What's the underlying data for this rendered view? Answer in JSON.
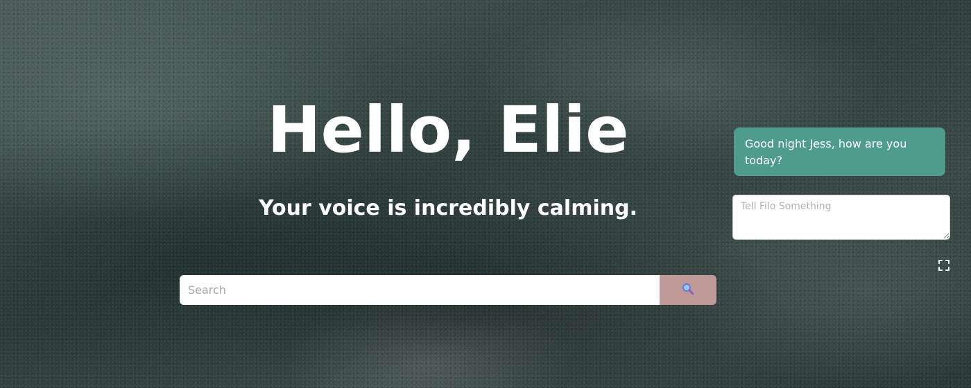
{
  "main": {
    "greeting": "Hello, Elie",
    "compliment": "Your voice is incredibly calming."
  },
  "search": {
    "placeholder": "Search",
    "value": "",
    "button_icon": "search-icon",
    "button_color": "#c09a99"
  },
  "chat": {
    "message": "Good night Jess, how are you today?",
    "bubble_color": "#4f9b8c",
    "input_placeholder": "Tell Filo Something",
    "input_value": ""
  },
  "controls": {
    "fullscreen_icon": "fullscreen-icon"
  }
}
